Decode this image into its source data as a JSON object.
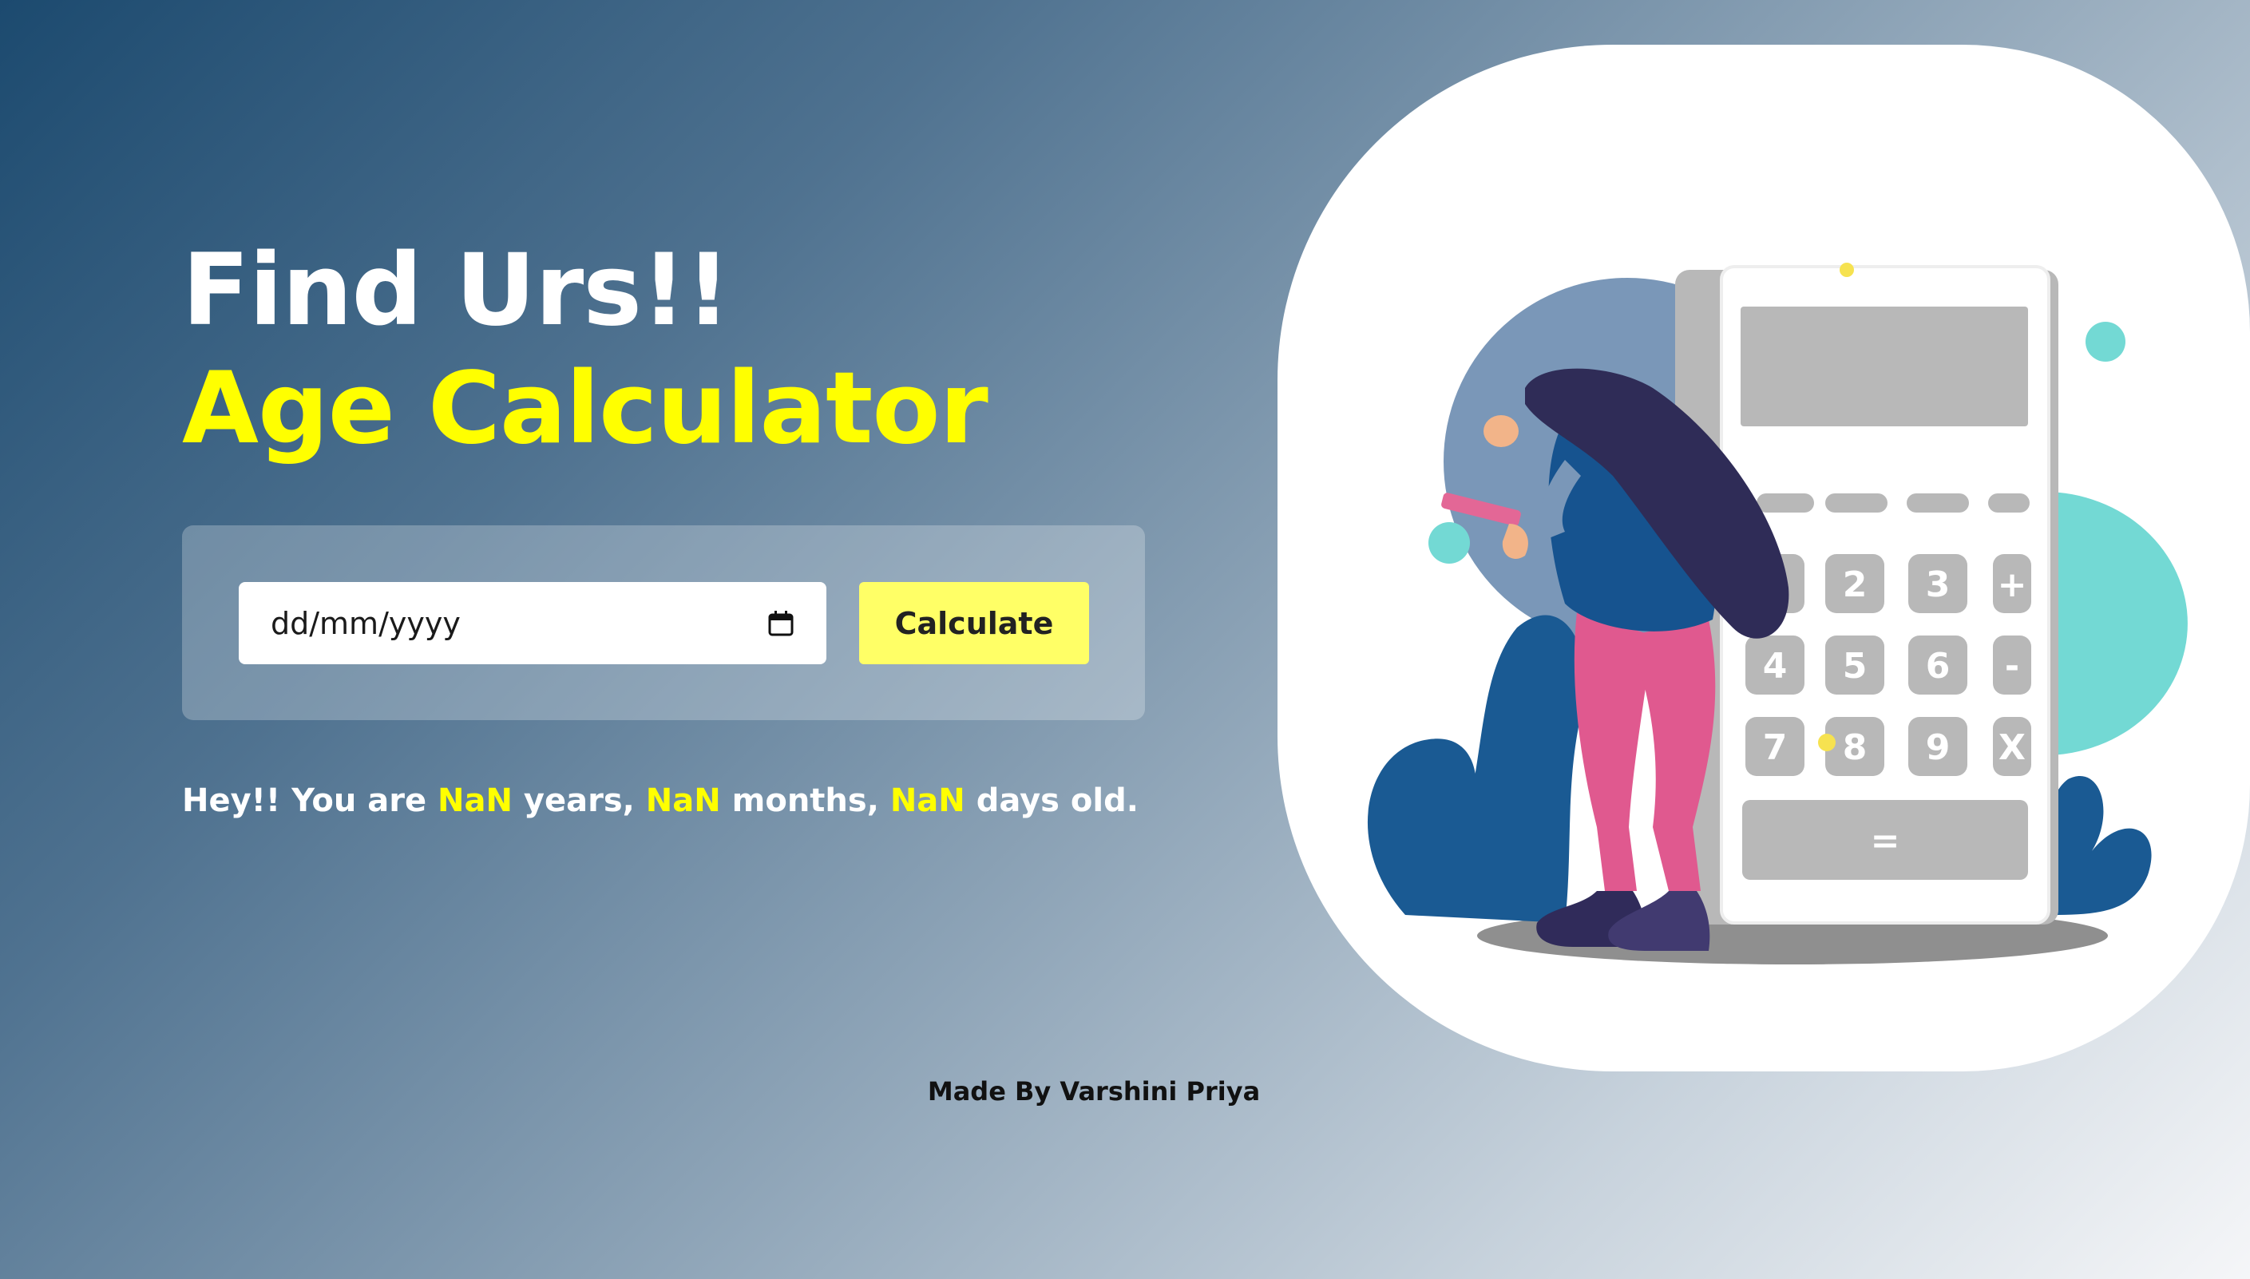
{
  "hero": {
    "title_line1": "Find Urs!!",
    "title_line2": "Age Calculator"
  },
  "form": {
    "date_placeholder": "dd/mm/yyyy",
    "date_value": "",
    "calendar_icon": "calendar-icon",
    "calculate_label": "Calculate"
  },
  "result": {
    "prefix": "Hey!! You are ",
    "years_value": "NaN",
    "years_suffix": " years, ",
    "months_value": "NaN",
    "months_suffix": " months, ",
    "days_value": "NaN",
    "days_suffix": " days old."
  },
  "footer": {
    "credit": "Made By Varshini Priya"
  },
  "illustration": {
    "keypad_keys": [
      "2",
      "3",
      "+",
      "4",
      "5",
      "6",
      "-",
      "7",
      "8",
      "9",
      "X",
      "="
    ]
  },
  "colors": {
    "accent_yellow": "#ffff00",
    "button_yellow": "#ffff66",
    "title_white": "#ffffff",
    "gradient_dark": "#1c4a6f",
    "gradient_light": "#f5f6f8"
  }
}
